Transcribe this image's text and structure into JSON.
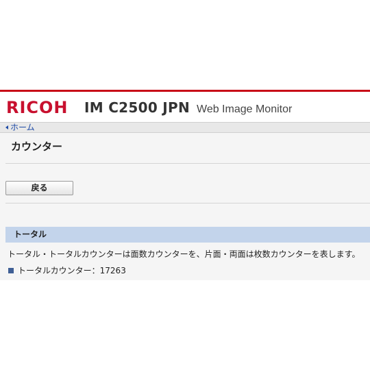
{
  "header": {
    "logo": "RICOH",
    "model": "IM C2500 JPN",
    "product": "Web Image Monitor",
    "accent_color": "#c80b17"
  },
  "breadcrumb": {
    "home_label": "ホーム",
    "icon": "chevron-left-icon"
  },
  "page": {
    "title": "カウンター",
    "back_label": "戻る"
  },
  "section": {
    "title": "トータル",
    "header_color": "#c3d4eb",
    "description": "トータル・トータルカウンターは面数カウンターを、片面・両面は枚数カウンターを表します。",
    "counter_label": "トータルカウンター：",
    "counter_value": "17263",
    "bullet_icon": "square-bullet-icon"
  }
}
